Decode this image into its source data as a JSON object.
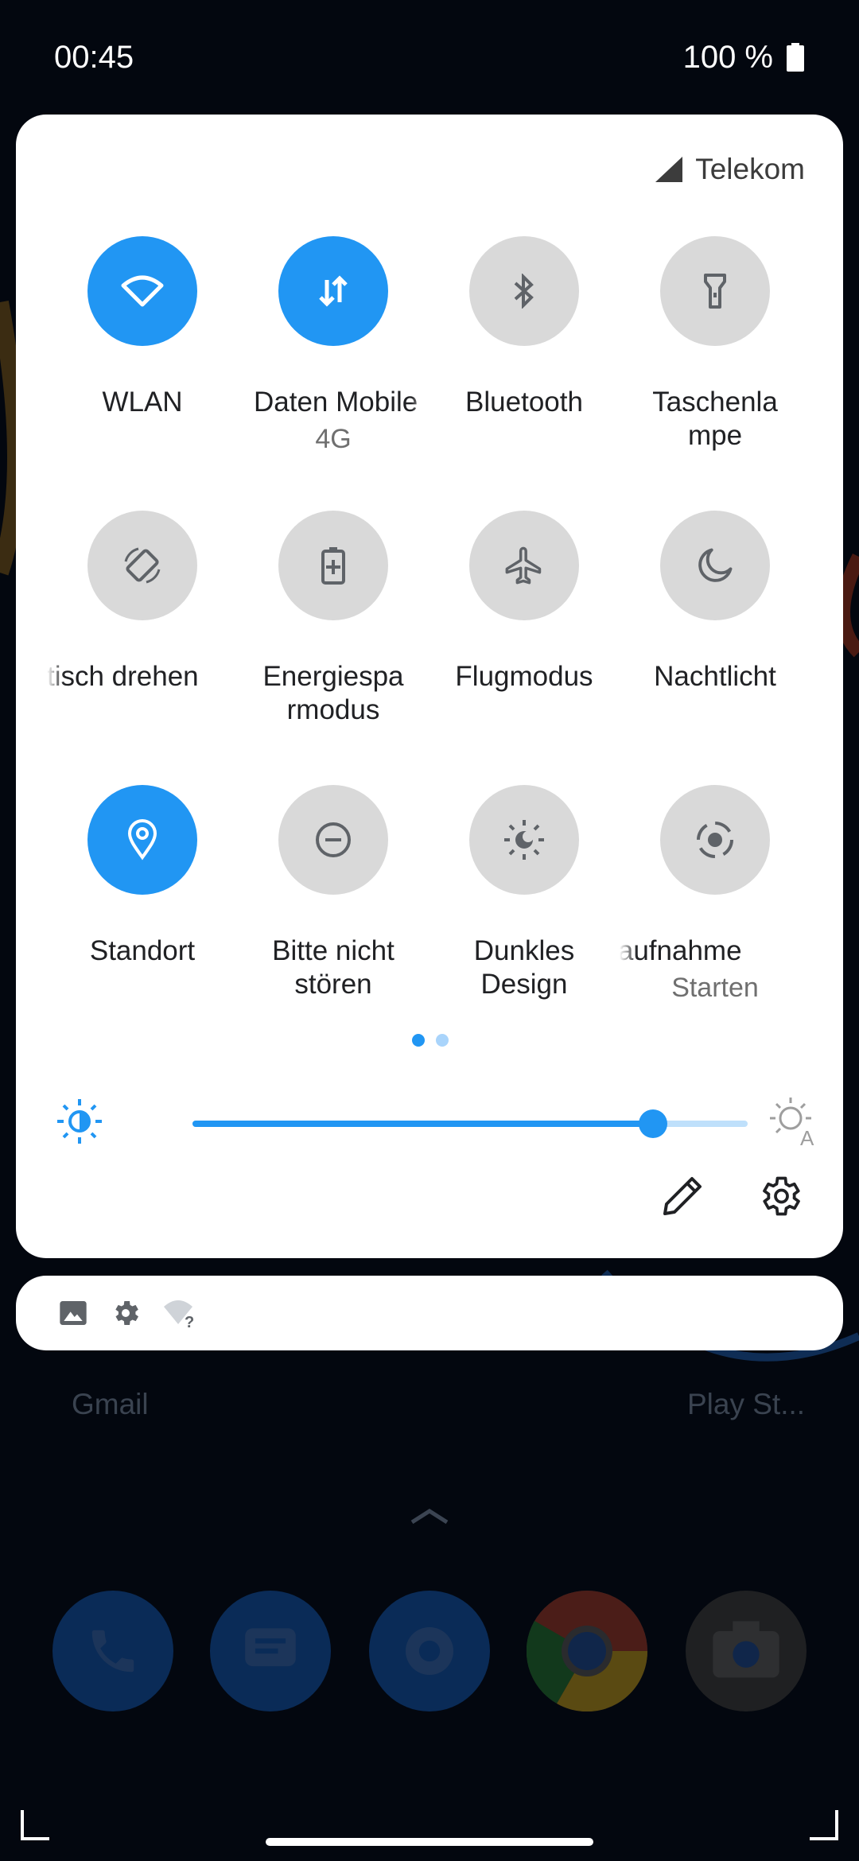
{
  "status_bar": {
    "time": "00:45",
    "battery": "100 %"
  },
  "carrier": "Telekom",
  "tiles": [
    {
      "label": "WLAN",
      "sub": "",
      "on": true,
      "icon": "wifi-icon"
    },
    {
      "label": "Daten        Mobile",
      "sub": "4G",
      "on": true,
      "icon": "mobile-data-icon"
    },
    {
      "label": "Bluetooth",
      "sub": "",
      "on": false,
      "icon": "bluetooth-icon"
    },
    {
      "label": "Taschenla\nmpe",
      "sub": "",
      "on": false,
      "icon": "flashlight-icon"
    },
    {
      "label": "Automatisch drehen",
      "sub": "",
      "on": false,
      "icon": "auto-rotate-icon"
    },
    {
      "label": "Energiespa\nrmodus",
      "sub": "",
      "on": false,
      "icon": "battery-saver-icon"
    },
    {
      "label": "Flugmodus",
      "sub": "",
      "on": false,
      "icon": "airplane-icon"
    },
    {
      "label": "Nachtlicht",
      "sub": "",
      "on": false,
      "icon": "moon-icon"
    },
    {
      "label": "Standort",
      "sub": "",
      "on": true,
      "icon": "location-pin-icon"
    },
    {
      "label": "Bitte nicht\nstören",
      "sub": "",
      "on": false,
      "icon": "do-not-disturb-icon"
    },
    {
      "label": "Dunkles\nDesign",
      "sub": "",
      "on": false,
      "icon": "dark-theme-icon"
    },
    {
      "label": "Bildschirmaufnahme",
      "sub": "Starten",
      "on": false,
      "icon": "screen-record-icon"
    }
  ],
  "brightness": {
    "level": 0.83
  },
  "page_indicator": {
    "pages": 2,
    "current": 1
  },
  "background": {
    "apps": [
      "Gmail",
      "Play St..."
    ]
  },
  "colors": {
    "accent": "#2196f3",
    "tile_off": "#d9d9d9",
    "panel": "#ffffff",
    "bg": "#03070f"
  }
}
